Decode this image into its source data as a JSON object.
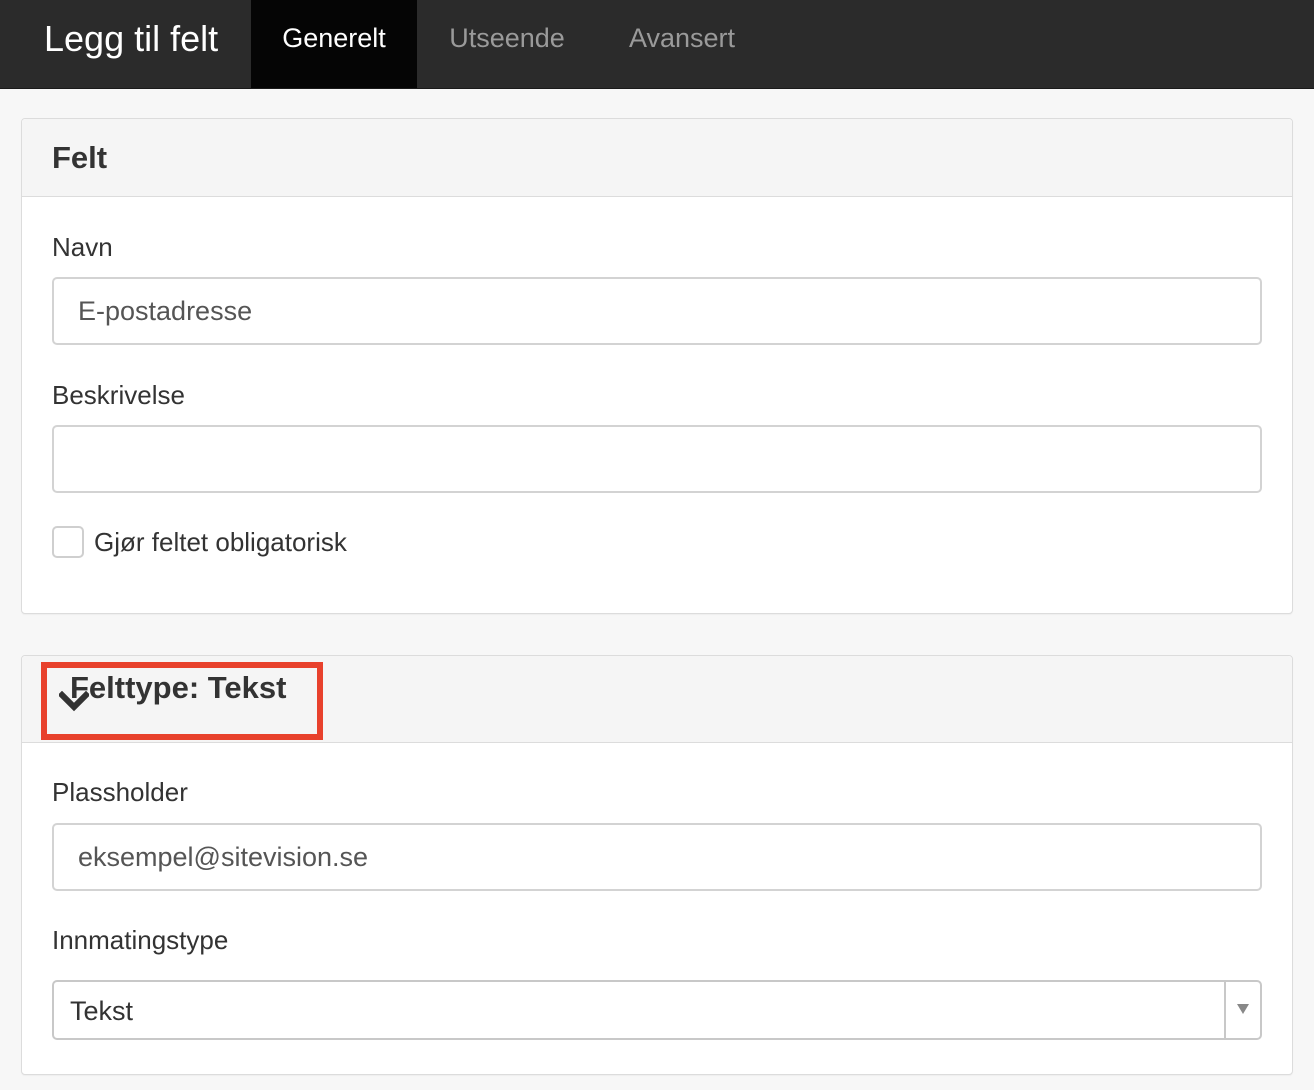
{
  "header": {
    "title": "Legg til felt",
    "tabs": [
      {
        "label": "Generelt",
        "active": true
      },
      {
        "label": "Utseende",
        "active": false
      },
      {
        "label": "Avansert",
        "active": false
      }
    ]
  },
  "felt_panel": {
    "title": "Felt",
    "navn": {
      "label": "Navn",
      "value": "E-postadresse"
    },
    "beskrivelse": {
      "label": "Beskrivelse",
      "value": ""
    },
    "required_checkbox": {
      "label": "Gjør feltet obligatorisk",
      "checked": false
    }
  },
  "felttype_panel": {
    "title": "Felttype: Tekst",
    "toggle_icon": "chevron-down-icon",
    "highlight_color": "#e8412c",
    "plassholder": {
      "label": "Plassholder",
      "value": "eksempel@sitevision.se"
    },
    "innmatingstype": {
      "label": "Innmatingstype",
      "selected": "Tekst"
    }
  },
  "colors": {
    "topbar_bg": "#2b2b2b",
    "active_tab_bg": "#050505",
    "page_bg": "#f7f7f7"
  }
}
